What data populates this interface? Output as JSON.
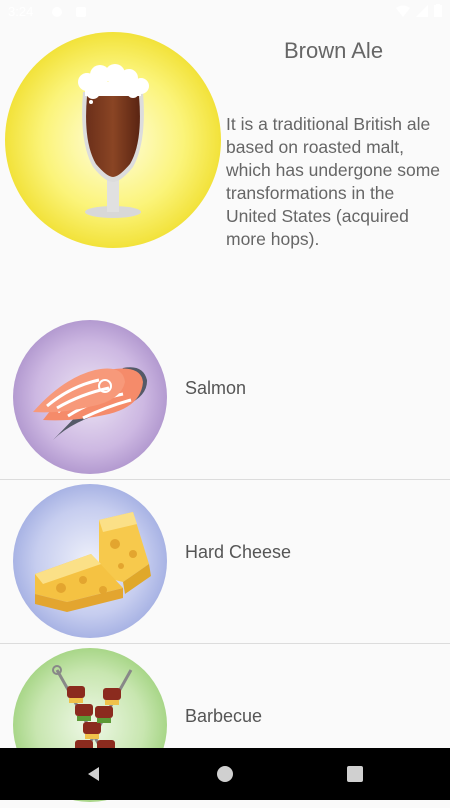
{
  "status_bar": {
    "time": "3:24"
  },
  "beer": {
    "name": "Brown Ale",
    "description": "It is a traditional British ale based on roasted malt, which has undergone some transformations in the United States (acquired more hops)."
  },
  "pairings": [
    {
      "label": "Salmon",
      "icon": "salmon-icon"
    },
    {
      "label": "Hard Cheese",
      "icon": "cheese-icon"
    },
    {
      "label": "Barbecue",
      "icon": "barbecue-icon"
    }
  ],
  "nav": {
    "back": "back-icon",
    "home": "home-icon",
    "recents": "recents-icon"
  },
  "colors": {
    "status_bar_text": "#ffffff",
    "nav_bar": "#000000",
    "divider": "#dcdcdc"
  }
}
